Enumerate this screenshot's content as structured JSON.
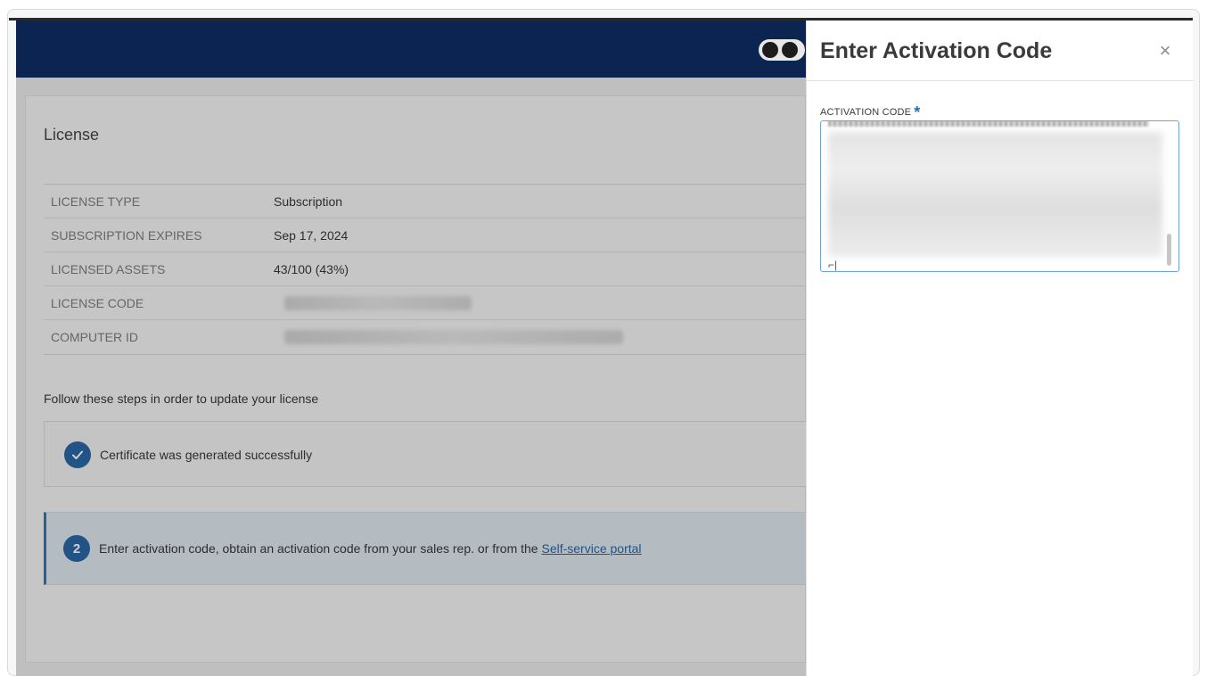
{
  "license": {
    "title": "License",
    "rows": [
      {
        "label": "LICENSE TYPE",
        "value": "Subscription"
      },
      {
        "label": "SUBSCRIPTION EXPIRES",
        "value": "Sep 17, 2024"
      },
      {
        "label": "LICENSED ASSETS",
        "value": "43/100 (43%)"
      },
      {
        "label": "LICENSE CODE",
        "value": ""
      },
      {
        "label": "COMPUTER ID",
        "value": ""
      }
    ]
  },
  "steps": {
    "intro": "Follow these steps in order to update your license",
    "step1": {
      "text": "Certificate was generated successfully"
    },
    "step2": {
      "number": "2",
      "text": "Enter activation code, obtain an activation code from your sales rep. or from the ",
      "link": "Self-service portal"
    }
  },
  "panel": {
    "title": "Enter Activation Code",
    "close": "×",
    "field_label": "ACTIVATION CODE",
    "required_mark": "*"
  },
  "colors": {
    "topbar": "#0b2451",
    "accent": "#1f5fa0",
    "link": "#1d5fa8"
  }
}
